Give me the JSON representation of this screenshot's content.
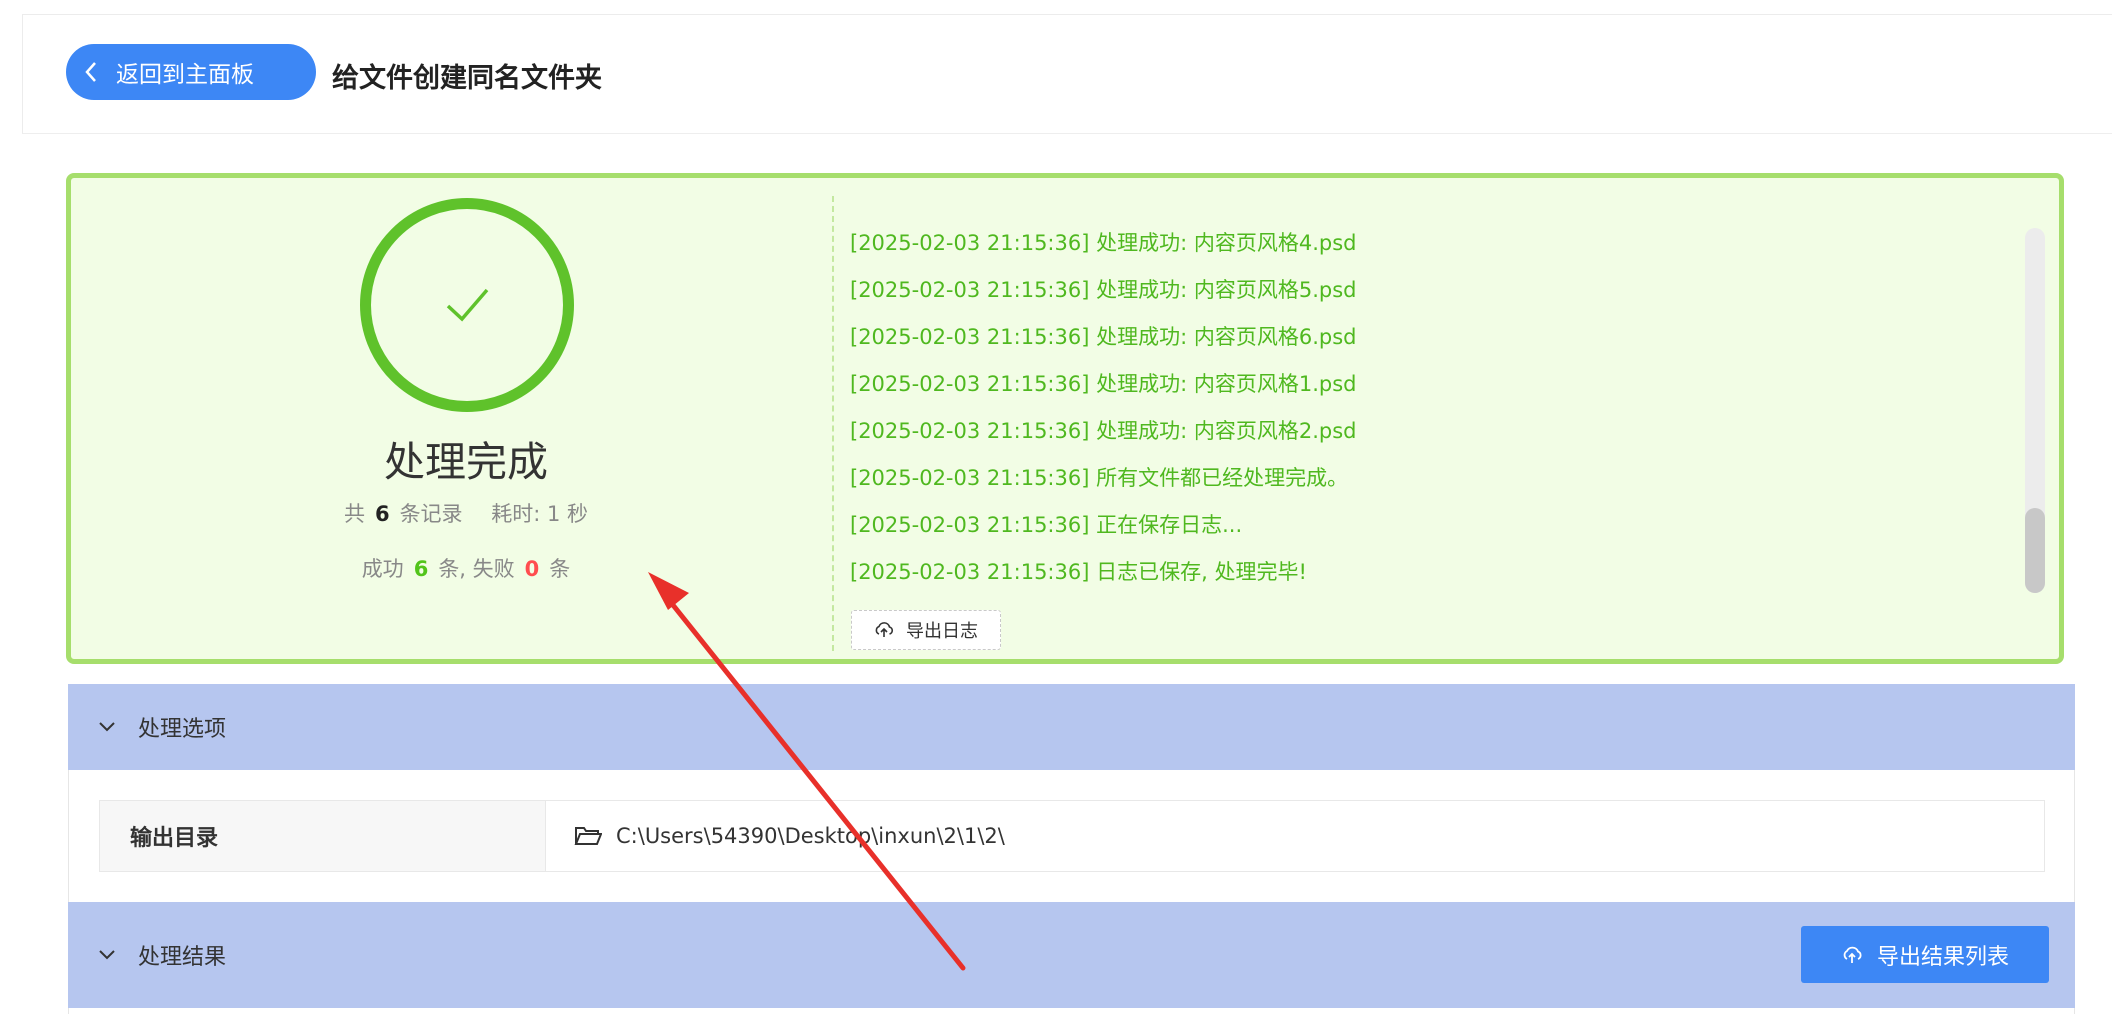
{
  "header": {
    "back_label": "返回到主面板",
    "title": "给文件创建同名文件夹"
  },
  "result": {
    "status_title": "处理完成",
    "total_prefix": "共",
    "total_count": "6",
    "total_suffix": "条记录",
    "time_label": "耗时: 1 秒",
    "success_prefix": "成功",
    "success_count": "6",
    "success_suffix": "条, 失败",
    "fail_count": "0",
    "fail_suffix": "条",
    "success_color": "#52c41a",
    "fail_color": "#ff4d4f"
  },
  "log": {
    "lines": [
      "[2025-02-03 21:15:36] 处理成功: 内容页风格4.psd",
      "[2025-02-03 21:15:36] 处理成功: 内容页风格5.psd",
      "[2025-02-03 21:15:36] 处理成功: 内容页风格6.psd",
      "[2025-02-03 21:15:36] 处理成功: 内容页风格1.psd",
      "[2025-02-03 21:15:36] 处理成功: 内容页风格2.psd",
      "[2025-02-03 21:15:36] 所有文件都已经处理完成。",
      "[2025-02-03 21:15:36] 正在保存日志...",
      "[2025-02-03 21:15:36] 日志已保存, 处理完毕!"
    ],
    "export_label": "导出日志"
  },
  "options": {
    "section_label": "处理选项",
    "output_dir_label": "输出目录",
    "output_dir_value": "C:\\Users\\54390\\Desktop\\inxun\\2\\1\\2\\"
  },
  "results": {
    "section_label": "处理结果",
    "export_label": "导出结果列表"
  },
  "icons": {
    "back": "chevron-left-icon",
    "check": "check-icon",
    "upload": "cloud-upload-icon",
    "collapse": "chevron-down-icon",
    "folder": "folder-open-icon"
  },
  "colors": {
    "primary": "#3d87f5",
    "success": "#52c41a",
    "result_border": "#a6de6c",
    "result_bg": "#f2fde5",
    "section_header": "#b6c6ef",
    "annotation_arrow": "#e8302a"
  }
}
